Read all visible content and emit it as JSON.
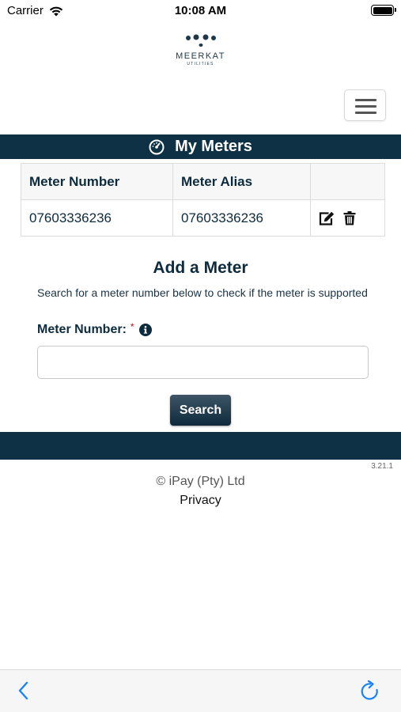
{
  "status_bar": {
    "carrier": "Carrier",
    "time": "10:08 AM",
    "icons": [
      "wifi-icon",
      "battery-icon"
    ]
  },
  "header": {
    "logo_text": "MEERKAT",
    "logo_sub": "UTILITIES",
    "menu_icon": "hamburger-icon"
  },
  "meters_section": {
    "title": "My Meters",
    "icon": "gauge-icon",
    "columns": [
      "Meter Number",
      "Meter Alias",
      ""
    ],
    "rows": [
      {
        "meter_number": "07603336236",
        "meter_alias": "07603336236",
        "actions": [
          "edit-icon",
          "trash-icon"
        ]
      }
    ]
  },
  "add_meter": {
    "title": "Add a Meter",
    "help": "Search for a meter number below to check if the meter is supported",
    "field_label": "Meter Number:",
    "required_mark": "*",
    "info_icon": "info-icon",
    "input_value": "",
    "search_label": "Search"
  },
  "footer": {
    "version": "3.21.1",
    "copyright": "© iPay (Pty) Ltd",
    "privacy": "Privacy"
  },
  "toolbar": {
    "back_icon": "back-chevron-icon",
    "reload_icon": "reload-icon"
  },
  "colors": {
    "brand_navy": "#0e3146",
    "text_navy": "#0d2b3e",
    "ios_blue": "#1a82fb",
    "required_red": "#d0021b"
  }
}
